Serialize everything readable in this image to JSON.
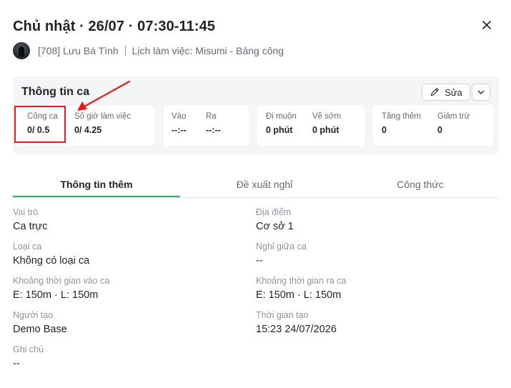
{
  "header": {
    "title": "Chủ nhật · 26/07 · 07:30-11:45",
    "employee": "[708] Lưu Bá Tình",
    "schedule": "Lịch làm việc: Misumi - Bảng công"
  },
  "shift_info": {
    "title": "Thông tin ca",
    "edit_label": "Sửa",
    "stats": {
      "cong_ca": {
        "label": "Công ca",
        "value": "0/ 0.5"
      },
      "so_gio": {
        "label": "Số giờ làm việc",
        "value": "0/ 4.25"
      },
      "vao": {
        "label": "Vào",
        "value": "--:--"
      },
      "ra": {
        "label": "Ra",
        "value": "--:--"
      },
      "di_muon": {
        "label": "Đi muộn",
        "value": "0 phút"
      },
      "ve_som": {
        "label": "Về sớm",
        "value": "0 phút"
      },
      "tang_them": {
        "label": "Tăng thêm",
        "value": "0"
      },
      "giam_tru": {
        "label": "Giảm trừ",
        "value": "0"
      }
    }
  },
  "tabs": [
    {
      "label": "Thông tin thêm",
      "active": true
    },
    {
      "label": "Đề xuất nghỉ",
      "active": false
    },
    {
      "label": "Công thức",
      "active": false
    }
  ],
  "details": {
    "vai_tro": {
      "label": "Vai trò",
      "value": "Ca trực"
    },
    "dia_diem": {
      "label": "Địa điểm",
      "value": "Cơ sở 1"
    },
    "loai_ca": {
      "label": "Loại ca",
      "value": "Không có loại ca"
    },
    "nghi_giua_ca": {
      "label": "Nghỉ giữa ca",
      "value": "--"
    },
    "kt_vao_ca": {
      "label": "Khoảng thời gian vào ca",
      "value": "E: 150m · L: 150m"
    },
    "kt_ra_ca": {
      "label": "Khoảng thời gian ra ca",
      "value": "E: 150m · L: 150m"
    },
    "nguoi_tao": {
      "label": "Người tạo",
      "value": "Demo Base"
    },
    "thoi_gian_tao": {
      "label": "Thời gian tạo",
      "value": "15:23 24/07/2026"
    },
    "ghi_chu": {
      "label": "Ghi chú",
      "value": "--"
    }
  },
  "colors": {
    "accent": "#2bae66",
    "annotation_red": "#e21c1c",
    "panel_bg": "#f4f5f7"
  },
  "icons": [
    "close-icon",
    "pencil-icon",
    "chevron-down-icon"
  ]
}
